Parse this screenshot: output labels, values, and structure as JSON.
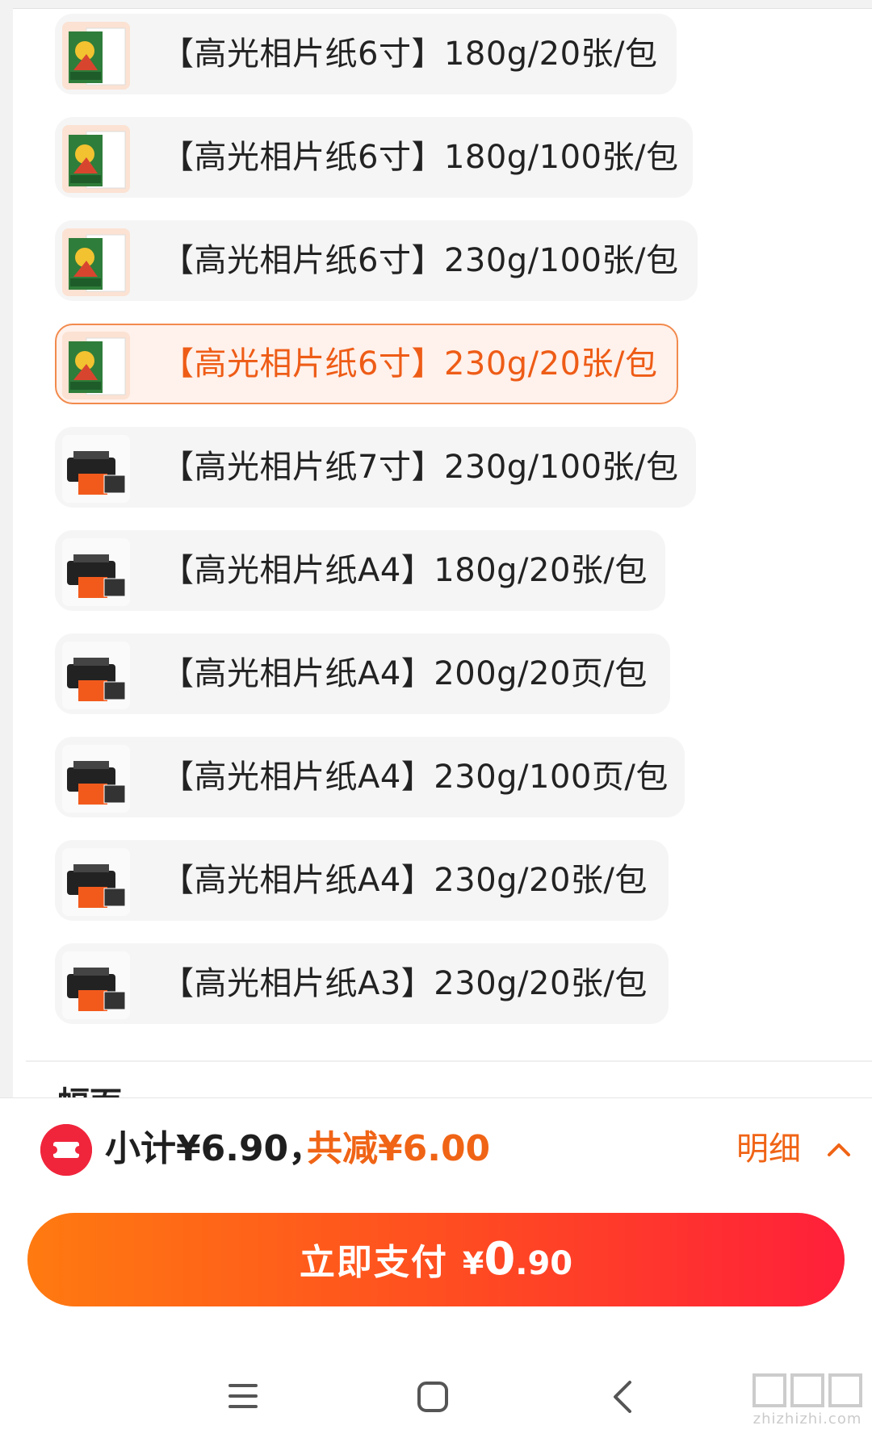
{
  "options": [
    {
      "label": "【高光相片纸6寸】180g/20张/包",
      "thumb": "photo-paper",
      "selected": false
    },
    {
      "label": "【高光相片纸6寸】180g/100张/包",
      "thumb": "photo-paper",
      "selected": false
    },
    {
      "label": "【高光相片纸6寸】230g/100张/包",
      "thumb": "photo-paper",
      "selected": false
    },
    {
      "label": "【高光相片纸6寸】230g/20张/包",
      "thumb": "photo-paper",
      "selected": true
    },
    {
      "label": "【高光相片纸7寸】230g/100张/包",
      "thumb": "printer",
      "selected": false
    },
    {
      "label": "【高光相片纸A4】180g/20张/包",
      "thumb": "printer",
      "selected": false
    },
    {
      "label": "【高光相片纸A4】200g/20页/包",
      "thumb": "printer",
      "selected": false
    },
    {
      "label": "【高光相片纸A4】230g/100页/包",
      "thumb": "printer",
      "selected": false
    },
    {
      "label": "【高光相片纸A4】230g/20张/包",
      "thumb": "printer",
      "selected": false
    },
    {
      "label": "【高光相片纸A3】230g/20张/包",
      "thumb": "printer",
      "selected": false
    }
  ],
  "next_section": {
    "title": "幅面"
  },
  "footer": {
    "subtotal": "小计¥6.90，",
    "discount": "共减¥6.00",
    "detail_label": "明细",
    "pay_label": "立即支付",
    "pay_currency": "¥",
    "pay_int": "0",
    "pay_dec": ".90"
  },
  "watermark": {
    "text": "zhizhizhi.com"
  },
  "colors": {
    "accent": "#f06416",
    "selected_border": "#f28a4d",
    "pay_gradient_start": "#ff7a10",
    "pay_gradient_end": "#ff1f3a"
  },
  "icons": [
    "coupon-icon",
    "chevron-up-icon",
    "menu-icon",
    "home-icon",
    "back-icon"
  ]
}
